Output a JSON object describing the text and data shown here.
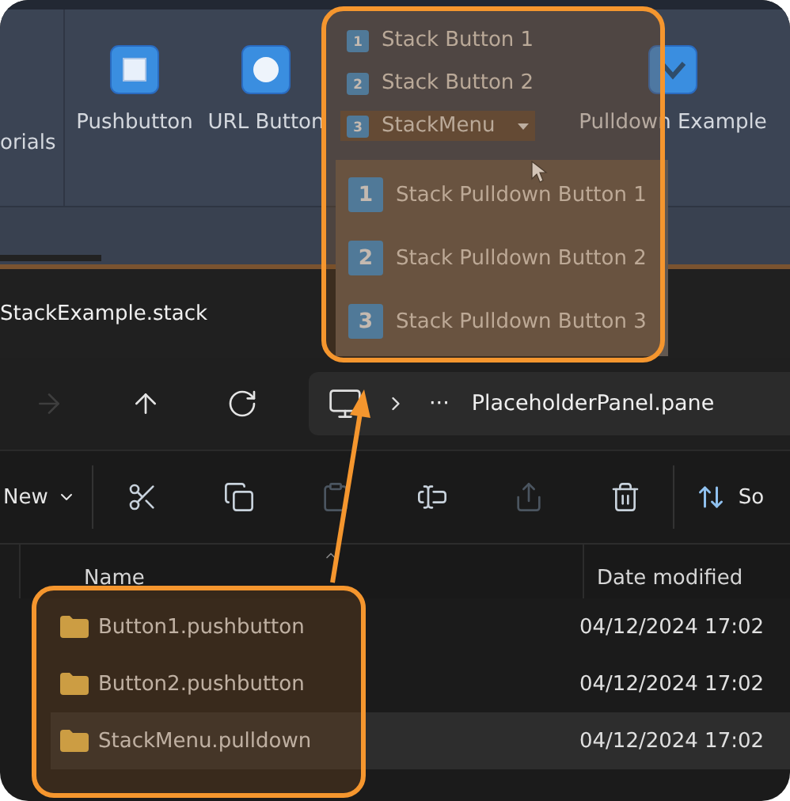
{
  "ribbon": {
    "panel_label": "orials",
    "buttons": [
      {
        "label": "Pushbutton",
        "kind": "push"
      },
      {
        "label": "URL Button",
        "kind": "url"
      }
    ],
    "stack": [
      {
        "label": "Stack Button 1",
        "badge": "1",
        "kind": "button"
      },
      {
        "label": "Stack Button 2",
        "badge": "2",
        "kind": "button"
      },
      {
        "label": "StackMenu",
        "badge": "3",
        "kind": "menu",
        "expanded": true
      }
    ],
    "pulldown": {
      "label": "Pulldown Example"
    },
    "menu_items": [
      {
        "label": "Stack Pulldown Button 1",
        "badge": "1"
      },
      {
        "label": "Stack Pulldown Button 2",
        "badge": "2"
      },
      {
        "label": "Stack Pulldown Button 3",
        "badge": "3"
      }
    ]
  },
  "explorer": {
    "tab_title": "StackExample.stack",
    "nav": [
      {
        "kind": "forward",
        "disabled": true
      },
      {
        "kind": "up",
        "disabled": false
      },
      {
        "kind": "refresh",
        "disabled": false
      }
    ],
    "breadcrumb_more": "···",
    "address": "PlaceholderPanel.pane",
    "new_label": "New",
    "toolbar": [
      {
        "kind": "cut",
        "disabled": false
      },
      {
        "kind": "copy",
        "disabled": false
      },
      {
        "kind": "paste",
        "disabled": true
      },
      {
        "kind": "rename",
        "disabled": false
      },
      {
        "kind": "share",
        "disabled": true
      },
      {
        "kind": "delete",
        "disabled": false
      }
    ],
    "sort_label": "So",
    "columns": [
      "Name",
      "Date modified"
    ],
    "rows": [
      {
        "name": "Button1.pushbutton",
        "date": "04/12/2024 17:02",
        "selected": false
      },
      {
        "name": "Button2.pushbutton",
        "date": "04/12/2024 17:02",
        "selected": false
      },
      {
        "name": "StackMenu.pulldown",
        "date": "04/12/2024 17:02",
        "selected": true
      }
    ]
  }
}
